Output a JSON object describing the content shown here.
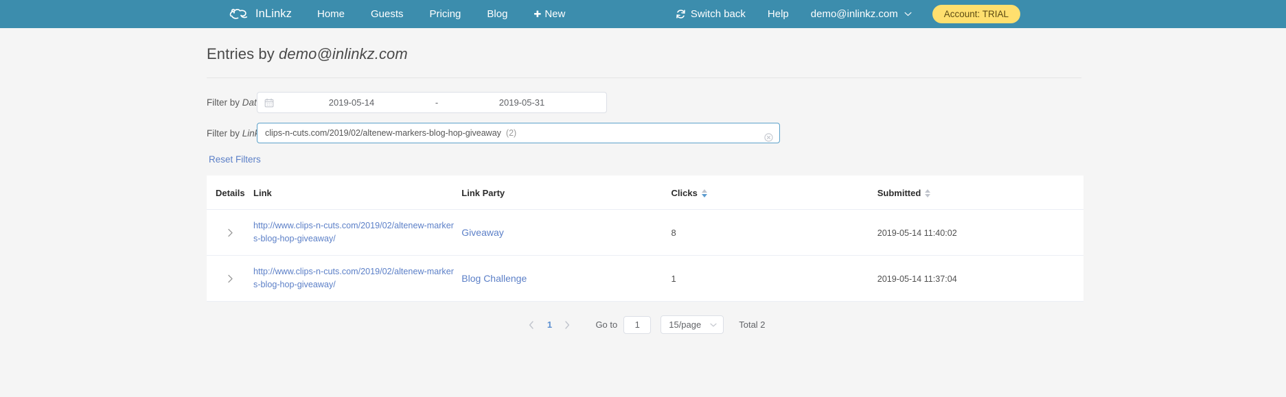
{
  "navbar": {
    "brand": {
      "label": "InLinkz",
      "icon": "frog-logo-icon"
    },
    "items": [
      {
        "label": "Home",
        "name": "nav-home"
      },
      {
        "label": "Guests",
        "name": "nav-guests"
      },
      {
        "label": "Pricing",
        "name": "nav-pricing"
      },
      {
        "label": "Blog",
        "name": "nav-blog"
      }
    ],
    "new_label": "New",
    "switch_back_label": "Switch back",
    "help_label": "Help",
    "user_email": "demo@inlinkz.com",
    "account_badge": "Account: TRIAL",
    "bg_color": "#3c8dad",
    "badge_color": "#ffdf6e"
  },
  "page": {
    "title_prefix": "Entries by ",
    "title_email": "demo@inlinkz.com"
  },
  "filters": {
    "date": {
      "label_prefix": "Filter by ",
      "label_em": "Date",
      "start": "2019-05-14",
      "separator": "-",
      "end": "2019-05-31",
      "icon": "calendar-icon"
    },
    "link": {
      "label_prefix": "Filter by ",
      "label_em": "Link",
      "value": "clips-n-cuts.com/2019/02/altenew-markers-blog-hop-giveaway",
      "count": "(2)",
      "clear_icon": "clear-circle-icon",
      "focus_color": "#5aa0c9"
    },
    "reset_label": "Reset Filters"
  },
  "table": {
    "columns": [
      {
        "label": "Details",
        "sortable": false
      },
      {
        "label": "Link",
        "sortable": false
      },
      {
        "label": "Link Party",
        "sortable": false
      },
      {
        "label": "Clicks",
        "sortable": true,
        "sort": "desc"
      },
      {
        "label": "Submitted",
        "sortable": true,
        "sort": "none"
      }
    ],
    "rows": [
      {
        "expand_icon": "chevron-right-icon",
        "link": "http://www.clips-n-cuts.com/2019/02/altenew-markers-blog-hop-giveaway/",
        "party": "Giveaway",
        "clicks": "8",
        "submitted": "2019-05-14 11:40:02"
      },
      {
        "expand_icon": "chevron-right-icon",
        "link": "http://www.clips-n-cuts.com/2019/02/altenew-markers-blog-hop-giveaway/",
        "party": "Blog Challenge",
        "clicks": "1",
        "submitted": "2019-05-14 11:37:04"
      }
    ]
  },
  "pagination": {
    "prev_icon": "chevron-left-icon",
    "next_icon": "chevron-right-icon",
    "current_page": "1",
    "goto_label": "Go to",
    "goto_value": "1",
    "page_size": "15/page",
    "total_label": "Total 2"
  }
}
